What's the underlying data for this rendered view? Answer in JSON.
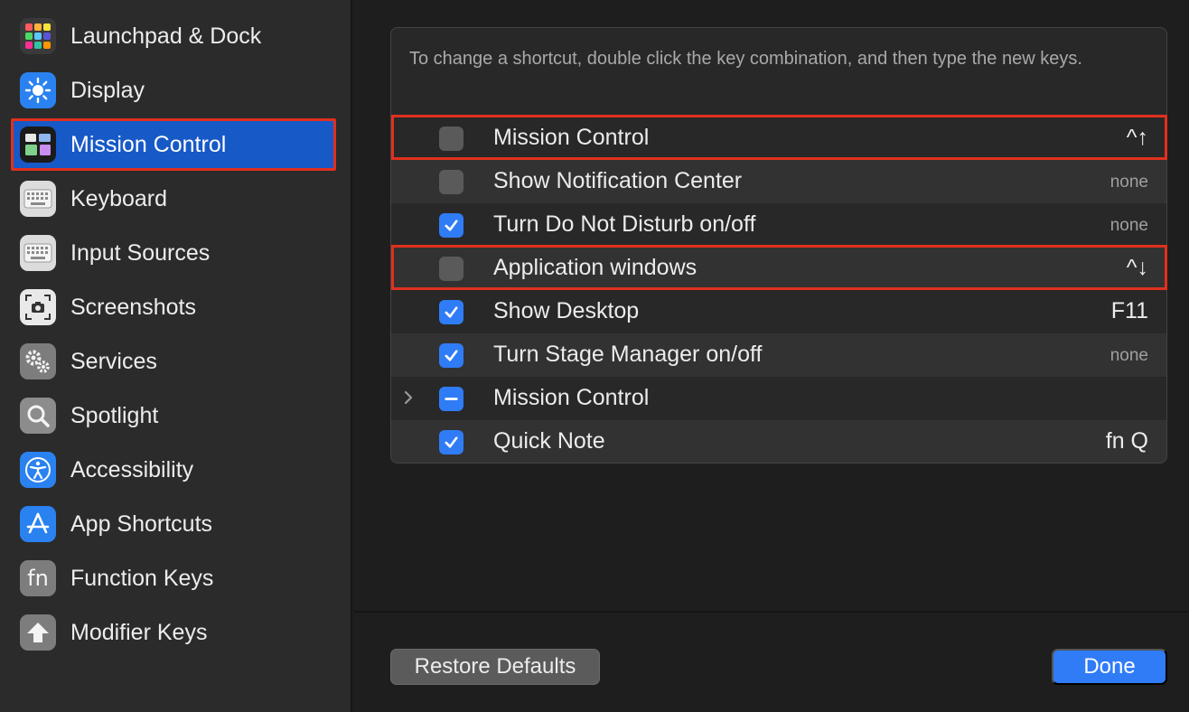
{
  "sidebar": {
    "items": [
      {
        "label": "Launchpad & Dock",
        "icon": "launchpad-icon"
      },
      {
        "label": "Display",
        "icon": "sun-icon"
      },
      {
        "label": "Mission Control",
        "icon": "mission-control-icon",
        "selected": true
      },
      {
        "label": "Keyboard",
        "icon": "keyboard-icon"
      },
      {
        "label": "Input Sources",
        "icon": "keyboard-icon"
      },
      {
        "label": "Screenshots",
        "icon": "camera-icon"
      },
      {
        "label": "Services",
        "icon": "gears-icon"
      },
      {
        "label": "Spotlight",
        "icon": "magnifier-icon"
      },
      {
        "label": "Accessibility",
        "icon": "accessibility-icon"
      },
      {
        "label": "App Shortcuts",
        "icon": "app-store-icon"
      },
      {
        "label": "Function Keys",
        "icon": "fn-icon"
      },
      {
        "label": "Modifier Keys",
        "icon": "up-arrow-icon"
      }
    ]
  },
  "main": {
    "hint": "To change a shortcut, double click the key combination, and then type the new keys.",
    "rows": [
      {
        "name": "Mission Control",
        "keys": "^↑",
        "state": "off",
        "highlighted": true
      },
      {
        "name": "Show Notification Center",
        "keys": "none",
        "state": "off"
      },
      {
        "name": "Turn Do Not Disturb on/off",
        "keys": "none",
        "state": "on"
      },
      {
        "name": "Application windows",
        "keys": "^↓",
        "state": "off",
        "highlighted": true
      },
      {
        "name": "Show Desktop",
        "keys": "F11",
        "state": "on"
      },
      {
        "name": "Turn Stage Manager on/off",
        "keys": "none",
        "state": "on"
      },
      {
        "name": "Mission Control",
        "keys": "",
        "state": "mixed",
        "expandable": true
      },
      {
        "name": "Quick Note",
        "keys": "fn Q",
        "state": "on"
      }
    ],
    "restore_label": "Restore Defaults",
    "done_label": "Done"
  },
  "colors": {
    "accent": "#2f7cf6",
    "selection": "#1759c7",
    "highlight_border": "#e0301e"
  }
}
